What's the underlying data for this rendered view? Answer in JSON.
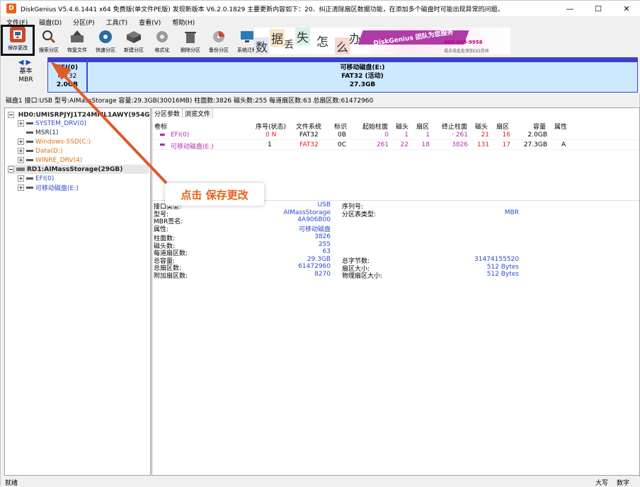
{
  "window": {
    "title": "DiskGenius V5.4.6.1441 x64 免费版(单文件PE版)  发现新版本 V6.2.0.1829  主要更新内容如下：20、纠正清除扇区数据功能，在添加多个磁盘时可能出现异常的问题。",
    "app_icon_letter": "D",
    "minimize": "—",
    "maximize": "☐",
    "close": "✕"
  },
  "menu": [
    "文件(F)",
    "磁盘(D)",
    "分区(P)",
    "工具(T)",
    "查看(V)",
    "帮助(H)"
  ],
  "toolbar": [
    {
      "label": "保存更改",
      "icon": "save-icon",
      "color": "#c84a2a"
    },
    {
      "label": "搜索分区",
      "icon": "search-icon",
      "color": "#3a3a3a"
    },
    {
      "label": "恢复文件",
      "icon": "recover-icon",
      "color": "#4a4a4a"
    },
    {
      "label": "快速分区",
      "icon": "quick-partition-icon",
      "color": "#2a6aa8"
    },
    {
      "label": "新建分区",
      "icon": "new-partition-icon",
      "color": "#555555"
    },
    {
      "label": "格式化",
      "icon": "format-icon",
      "color": "#666666"
    },
    {
      "label": "删除分区",
      "icon": "delete-icon",
      "color": "#777777"
    },
    {
      "label": "备份分区",
      "icon": "backup-icon",
      "color": "#888888"
    },
    {
      "label": "系统迁移",
      "icon": "migrate-icon",
      "color": "#2a7ab8"
    }
  ],
  "banner": {
    "chars": [
      "数",
      "据",
      "丢",
      "失",
      "怎",
      "么",
      "办"
    ],
    "slogan": "DiskGenius 团队为您服务",
    "phone": "400-008-9958",
    "qq": "或点击此处添加QQ咨询"
  },
  "diskmap": {
    "type_label": "基本",
    "scheme_label": "MBR",
    "nav_arrows": "◀▶",
    "partitions": [
      {
        "name": "EFI(0)",
        "fs": "FAT32",
        "size": "2.0GB"
      },
      {
        "name": "可移动磁盘(E:)",
        "fs": "FAT32 (活动)",
        "size": "27.3GB"
      }
    ]
  },
  "disk_info_line": "磁盘1 接口:USB  型号:AIMassStorage  容量:29.3GB(30016MB)  柱面数:3826  磁头数:255  每道扇区数:63  总扇区数:61472960",
  "tree": [
    {
      "label": "HD0:UMISRPJYJ1T24MML1AWY(954G",
      "level": 0,
      "type": "disk",
      "exp": "−",
      "color": "c-dark",
      "bold": true
    },
    {
      "label": "SYSTEM_DRV(0)",
      "level": 1,
      "type": "part",
      "exp": "+",
      "color": "c-blue"
    },
    {
      "label": "MSR(1)",
      "level": 1,
      "type": "part",
      "exp": "",
      "color": "c-dark"
    },
    {
      "label": "Windows-SSD(C:)",
      "level": 1,
      "type": "part",
      "exp": "+",
      "color": "c-orange"
    },
    {
      "label": "Data(D:)",
      "level": 1,
      "type": "part",
      "exp": "+",
      "color": "c-orange"
    },
    {
      "label": "WINRE_DRV(4)",
      "level": 1,
      "type": "part",
      "exp": "+",
      "color": "c-orange"
    },
    {
      "label": "RD1:AIMassStorage(29GB)",
      "level": 0,
      "type": "disk",
      "exp": "−",
      "color": "c-dark",
      "bold": true,
      "selected": true
    },
    {
      "label": "EFI(0)",
      "level": 1,
      "type": "part",
      "exp": "+",
      "color": "c-blue"
    },
    {
      "label": "可移动磁盘(E:)",
      "level": 1,
      "type": "part",
      "exp": "+",
      "color": "c-blue"
    }
  ],
  "tabs": [
    "分区参数",
    "浏览文件"
  ],
  "table": {
    "headers": [
      "卷标",
      "序号(状态)",
      "文件系统",
      "标识",
      "起始柱面",
      "磁头",
      "扇区",
      "终止柱面",
      "磁头",
      "扇区",
      "容量",
      "属性"
    ],
    "rows": [
      {
        "label": "EFI(0)",
        "idx": "0 N",
        "fs": "FAT32",
        "id": "0B",
        "sc": "0",
        "sh": "1",
        "ss": "1",
        "ec": "· 261",
        "eh": "21",
        "es": "16",
        "cap": "2.0GB",
        "attr": ""
      },
      {
        "label": "可移动磁盘(E:)",
        "idx": "1",
        "fs": "FAT32",
        "id": "0C",
        "sc": "261",
        "sh": "22",
        "ss": "18",
        "ec": "3826",
        "eh": "131",
        "es": "17",
        "cap": "27.3GB",
        "attr": "A"
      }
    ]
  },
  "props": {
    "group1": [
      {
        "k": "接口类型:",
        "v": "USB"
      },
      {
        "k": "型号:",
        "v": "AIMassStorage"
      },
      {
        "k": "MBR签名:",
        "v": "4A906B00"
      },
      {
        "k": "属性:",
        "v": "可移动磁盘"
      }
    ],
    "group1_right": [
      {
        "k": "序列号:",
        "v": ""
      },
      {
        "k": "分区表类型:",
        "v": "MBR"
      }
    ],
    "group2": [
      {
        "k": "柱面数:",
        "v": "3826"
      },
      {
        "k": "磁头数:",
        "v": "255"
      },
      {
        "k": "每道扇区数:",
        "v": "63"
      },
      {
        "k": "总容量:",
        "v": "29.3GB"
      },
      {
        "k": "总扇区数:",
        "v": "61472960"
      },
      {
        "k": "附加扇区数:",
        "v": "8270"
      }
    ],
    "group2_right": [
      {
        "k": "总字节数:",
        "v": "31474155520"
      },
      {
        "k": "扇区大小:",
        "v": "512 Bytes"
      },
      {
        "k": "物理扇区大小:",
        "v": "512 Bytes"
      }
    ]
  },
  "status": {
    "left": "就绪",
    "right1": "大写",
    "right2": "数字"
  },
  "annotation": {
    "text": "点击 保存更改",
    "color": "#e8621c"
  }
}
